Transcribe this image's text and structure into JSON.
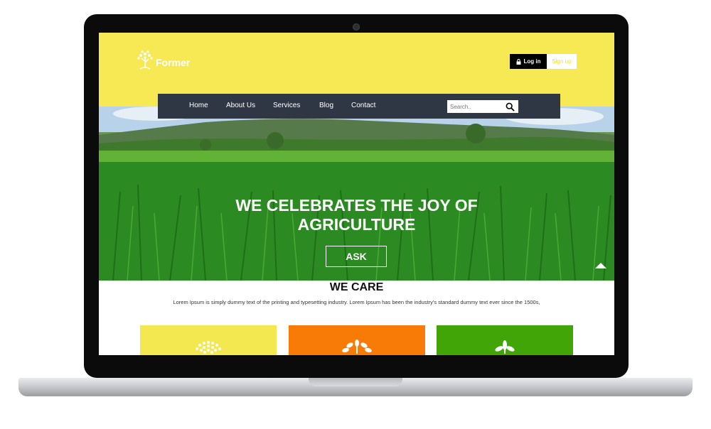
{
  "site": {
    "logo_text": "Former",
    "login_label": "Log in",
    "signup_label": "Sign up"
  },
  "nav": {
    "items": [
      "Home",
      "About Us",
      "Services",
      "Blog",
      "Contact"
    ],
    "search_placeholder": "Search.."
  },
  "hero": {
    "title_line1": "WE CELEBRATES THE JOY OF",
    "title_line2": "AGRICULTURE",
    "button_label": "ASK"
  },
  "care": {
    "title": "WE CARE",
    "text": "Lorem Ipsum is simply dummy text of the printing and typesetting industry. Lorem Ipsum has been the industry's standard dummy text ever since the 1500s,"
  },
  "cards": [
    {
      "color": "#f3e84f",
      "icon": "tree-dots-icon"
    },
    {
      "color": "#f87b08",
      "icon": "plant-branch-icon"
    },
    {
      "color": "#41a507",
      "icon": "sprout-icon"
    }
  ],
  "colors": {
    "brand_yellow": "#f6e953",
    "nav_dark": "#2f3744",
    "orange": "#f87b08",
    "green": "#41a507"
  }
}
